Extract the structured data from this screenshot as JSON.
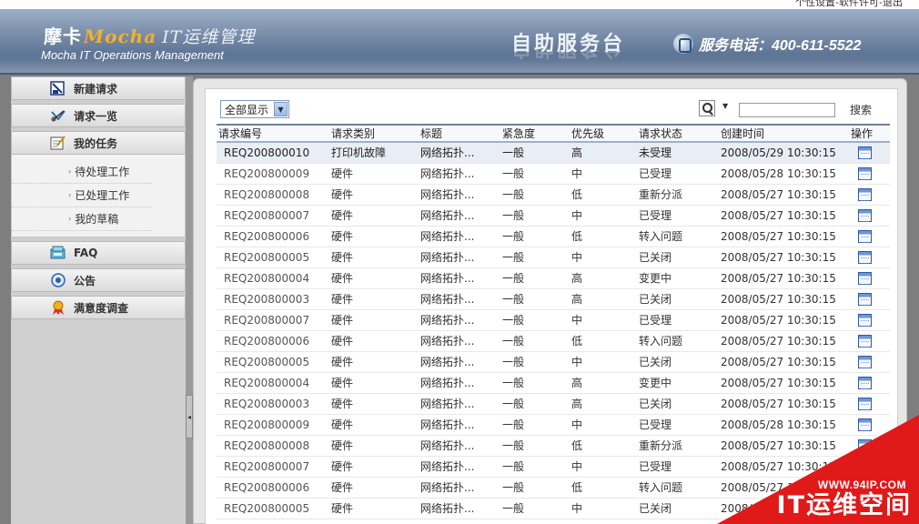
{
  "top_links": {
    "text": "个性设置-软件许可-退出"
  },
  "header": {
    "logo_cn": "摩卡",
    "logo_en": "Mocha",
    "logo_sub": "IT运维管理",
    "logo_tagline": "Mocha IT Operations Management",
    "center_title": "自助服务台",
    "phone": "服务电话：400-611-5522"
  },
  "sidebar": {
    "items": [
      {
        "label": "新建请求",
        "icon": "new-request-icon"
      },
      {
        "label": "请求一览",
        "icon": "request-list-icon"
      },
      {
        "label": "我的任务",
        "icon": "my-tasks-icon"
      }
    ],
    "sub_items": [
      {
        "label": "待处理工作"
      },
      {
        "label": "已处理工作"
      },
      {
        "label": "我的草稿"
      }
    ],
    "bottom_items": [
      {
        "label": "FAQ",
        "icon": "faq-icon"
      },
      {
        "label": "公告",
        "icon": "announcement-icon"
      },
      {
        "label": "满意度调查",
        "icon": "survey-icon"
      }
    ]
  },
  "toolbar": {
    "filter_value": "全部显示",
    "search_placeholder": "",
    "search_label": "搜索"
  },
  "table": {
    "headers": [
      "请求编号",
      "请求类别",
      "标题",
      "紧急度",
      "优先级",
      "请求状态",
      "创建时间",
      "操作"
    ],
    "rows": [
      {
        "id": "REQ200800010",
        "category": "打印机故障",
        "title": "网络拓扑...",
        "urgency": "一般",
        "priority": "高",
        "status": "未受理",
        "created": "2008/05/29 10:30:15"
      },
      {
        "id": "REQ200800009",
        "category": "硬件",
        "title": "网络拓扑...",
        "urgency": "一般",
        "priority": "中",
        "status": "已受理",
        "created": "2008/05/28 10:30:15"
      },
      {
        "id": "REQ200800008",
        "category": "硬件",
        "title": "网络拓扑...",
        "urgency": "一般",
        "priority": "低",
        "status": "重新分派",
        "created": "2008/05/27 10:30:15"
      },
      {
        "id": "REQ200800007",
        "category": "硬件",
        "title": "网络拓扑...",
        "urgency": "一般",
        "priority": "中",
        "status": "已受理",
        "created": "2008/05/27 10:30:15"
      },
      {
        "id": "REQ200800006",
        "category": "硬件",
        "title": "网络拓扑...",
        "urgency": "一般",
        "priority": "低",
        "status": "转入问题",
        "created": "2008/05/27 10:30:15"
      },
      {
        "id": "REQ200800005",
        "category": "硬件",
        "title": "网络拓扑...",
        "urgency": "一般",
        "priority": "中",
        "status": "已关闭",
        "created": "2008/05/27 10:30:15"
      },
      {
        "id": "REQ200800004",
        "category": "硬件",
        "title": "网络拓扑...",
        "urgency": "一般",
        "priority": "高",
        "status": "变更中",
        "created": "2008/05/27 10:30:15"
      },
      {
        "id": "REQ200800003",
        "category": "硬件",
        "title": "网络拓扑...",
        "urgency": "一般",
        "priority": "高",
        "status": "已关闭",
        "created": "2008/05/27 10:30:15"
      },
      {
        "id": "REQ200800007",
        "category": "硬件",
        "title": "网络拓扑...",
        "urgency": "一般",
        "priority": "中",
        "status": "已受理",
        "created": "2008/05/27 10:30:15"
      },
      {
        "id": "REQ200800006",
        "category": "硬件",
        "title": "网络拓扑...",
        "urgency": "一般",
        "priority": "低",
        "status": "转入问题",
        "created": "2008/05/27 10:30:15"
      },
      {
        "id": "REQ200800005",
        "category": "硬件",
        "title": "网络拓扑...",
        "urgency": "一般",
        "priority": "中",
        "status": "已关闭",
        "created": "2008/05/27 10:30:15"
      },
      {
        "id": "REQ200800004",
        "category": "硬件",
        "title": "网络拓扑...",
        "urgency": "一般",
        "priority": "高",
        "status": "变更中",
        "created": "2008/05/27 10:30:15"
      },
      {
        "id": "REQ200800003",
        "category": "硬件",
        "title": "网络拓扑...",
        "urgency": "一般",
        "priority": "高",
        "status": "已关闭",
        "created": "2008/05/27 10:30:15"
      },
      {
        "id": "REQ200800009",
        "category": "硬件",
        "title": "网络拓扑...",
        "urgency": "一般",
        "priority": "中",
        "status": "已受理",
        "created": "2008/05/28 10:30:15"
      },
      {
        "id": "REQ200800008",
        "category": "硬件",
        "title": "网络拓扑...",
        "urgency": "一般",
        "priority": "低",
        "status": "重新分派",
        "created": "2008/05/27 10:30:15"
      },
      {
        "id": "REQ200800007",
        "category": "硬件",
        "title": "网络拓扑...",
        "urgency": "一般",
        "priority": "中",
        "status": "已受理",
        "created": "2008/05/27 10:30:15"
      },
      {
        "id": "REQ200800006",
        "category": "硬件",
        "title": "网络拓扑...",
        "urgency": "一般",
        "priority": "低",
        "status": "转入问题",
        "created": "2008/05/27 10:30:15"
      },
      {
        "id": "REQ200800005",
        "category": "硬件",
        "title": "网络拓扑...",
        "urgency": "一般",
        "priority": "中",
        "status": "已关闭",
        "created": "2008/05/27 10:30:15"
      }
    ]
  },
  "watermark": {
    "site": "WWW.94IP.COM",
    "text": "IT运维空间",
    "color": "#e01919"
  },
  "colors": {
    "header_accent": "#f4b02b",
    "table_header_border": "#6f7f9d"
  }
}
